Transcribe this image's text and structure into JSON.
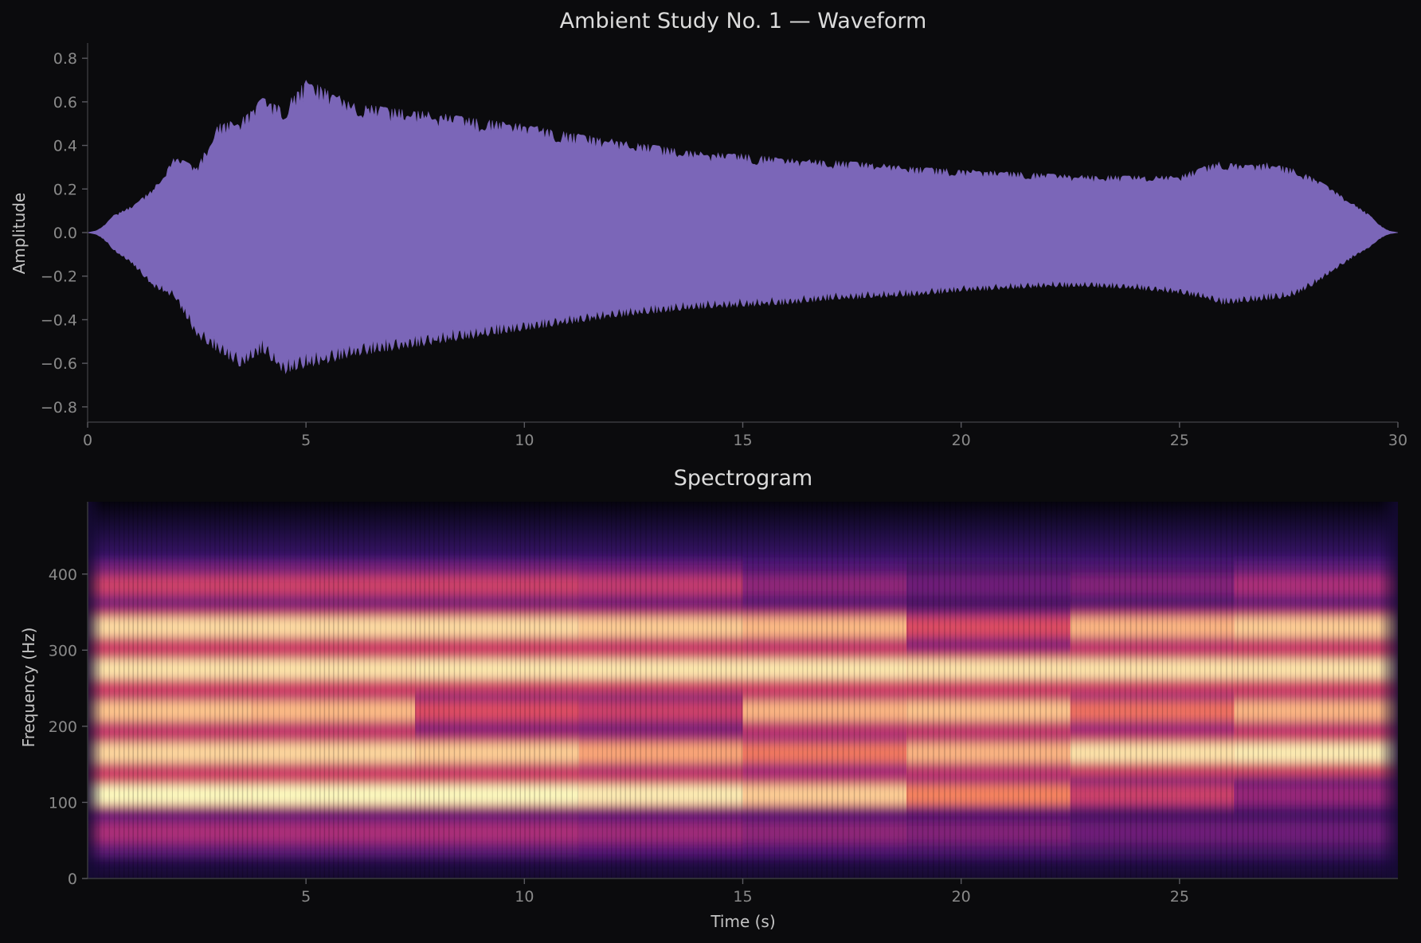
{
  "chart_data": [
    {
      "type": "area",
      "title": "Ambient Study No. 1 — Waveform",
      "xlabel": "",
      "ylabel": "Amplitude",
      "xlim": [
        0,
        30
      ],
      "ylim": [
        -0.87,
        0.87
      ],
      "x_ticks": [
        0,
        5,
        10,
        15,
        20,
        25,
        30
      ],
      "x_tick_labels": [
        "0",
        "5",
        "10",
        "15",
        "20",
        "25",
        "30"
      ],
      "y_ticks": [
        0.8,
        0.6,
        0.4,
        0.2,
        0.0,
        -0.2,
        -0.4,
        -0.6,
        -0.8
      ],
      "y_tick_labels": [
        "0.8",
        "0.6",
        "0.4",
        "0.2",
        "0.0",
        "−0.2",
        "−0.4",
        "−0.6",
        "−0.8"
      ],
      "color": "#7b66b8",
      "grid": false,
      "envelope": {
        "time": [
          0,
          0.5,
          1,
          1.5,
          2,
          2.5,
          3,
          3.5,
          4,
          4.5,
          5,
          5.5,
          6,
          7,
          8,
          9,
          10,
          11,
          12,
          13,
          14,
          15,
          16,
          17,
          18,
          19,
          20,
          21,
          22,
          23,
          24,
          25,
          25.5,
          26,
          26.5,
          27,
          27.5,
          28,
          28.5,
          29,
          29.5,
          30
        ],
        "upper": [
          0,
          0.07,
          0.12,
          0.2,
          0.35,
          0.3,
          0.5,
          0.52,
          0.62,
          0.58,
          0.7,
          0.66,
          0.6,
          0.57,
          0.55,
          0.52,
          0.5,
          0.46,
          0.43,
          0.4,
          0.37,
          0.36,
          0.34,
          0.33,
          0.32,
          0.3,
          0.29,
          0.28,
          0.27,
          0.26,
          0.26,
          0.26,
          0.3,
          0.33,
          0.31,
          0.32,
          0.3,
          0.26,
          0.2,
          0.13,
          0.06,
          0
        ],
        "lower": [
          0,
          -0.07,
          -0.14,
          -0.25,
          -0.3,
          -0.48,
          -0.55,
          -0.62,
          -0.55,
          -0.65,
          -0.62,
          -0.6,
          -0.57,
          -0.54,
          -0.51,
          -0.48,
          -0.45,
          -0.42,
          -0.39,
          -0.37,
          -0.35,
          -0.34,
          -0.33,
          -0.31,
          -0.3,
          -0.29,
          -0.27,
          -0.26,
          -0.25,
          -0.25,
          -0.26,
          -0.28,
          -0.3,
          -0.33,
          -0.32,
          -0.31,
          -0.3,
          -0.25,
          -0.18,
          -0.11,
          -0.05,
          0
        ]
      }
    },
    {
      "type": "heatmap",
      "title": "Spectrogram",
      "xlabel": "Time (s)",
      "ylabel": "Frequency (Hz)",
      "xlim": [
        0,
        30
      ],
      "ylim": [
        0,
        495
      ],
      "x_ticks": [
        5,
        10,
        15,
        20,
        25
      ],
      "x_tick_labels": [
        "5",
        "10",
        "15",
        "20",
        "25"
      ],
      "y_ticks": [
        0,
        100,
        200,
        300,
        400
      ],
      "y_tick_labels": [
        "0",
        "100",
        "200",
        "300",
        "400"
      ],
      "colormap": "magma",
      "harmonic_bands": [
        {
          "freq": 110,
          "strength": [
            1.0,
            1.0,
            1.0,
            0.97,
            0.9,
            0.75,
            0.55,
            0.4
          ]
        },
        {
          "freq": 165,
          "strength": [
            0.92,
            0.92,
            0.9,
            0.82,
            0.72,
            0.85,
            0.95,
            0.97
          ]
        },
        {
          "freq": 220,
          "strength": [
            0.88,
            0.86,
            0.6,
            0.55,
            0.85,
            0.88,
            0.7,
            0.85
          ]
        },
        {
          "freq": 275,
          "strength": [
            0.95,
            0.95,
            0.96,
            0.96,
            0.96,
            0.95,
            0.95,
            0.95
          ]
        },
        {
          "freq": 330,
          "strength": [
            0.93,
            0.93,
            0.93,
            0.9,
            0.86,
            0.6,
            0.85,
            0.9
          ]
        },
        {
          "freq": 385,
          "strength": [
            0.55,
            0.55,
            0.55,
            0.52,
            0.38,
            0.3,
            0.35,
            0.45
          ]
        },
        {
          "freq": 60,
          "strength": [
            0.45,
            0.45,
            0.45,
            0.42,
            0.38,
            0.35,
            0.3,
            0.3
          ]
        }
      ]
    }
  ]
}
